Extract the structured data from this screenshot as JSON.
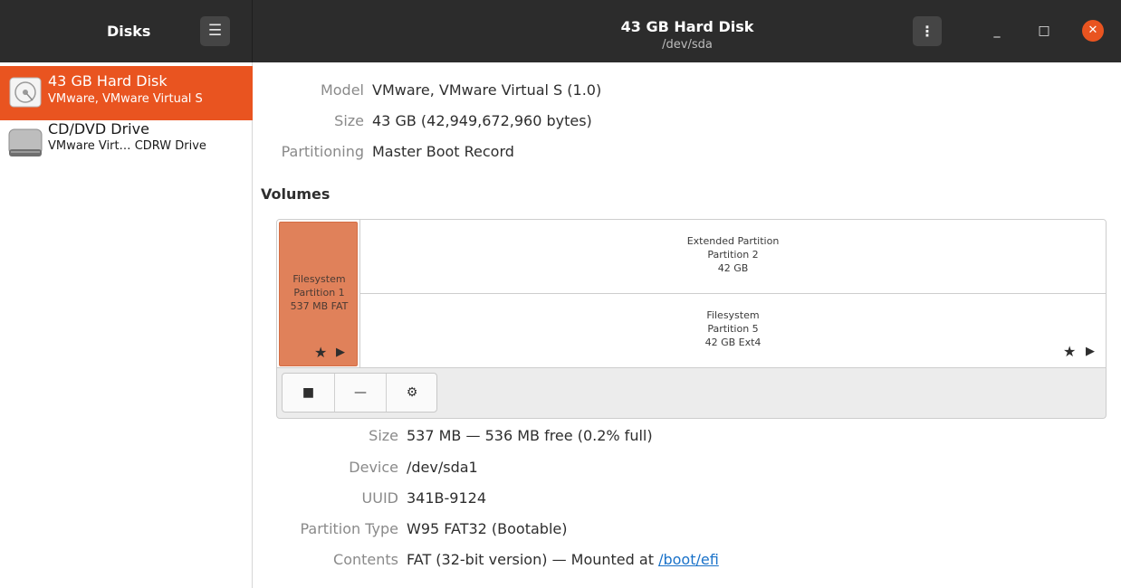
{
  "header": {
    "app_title": "Disks",
    "menu_icon": "hamburger-icon",
    "title": "43 GB Hard Disk",
    "subtitle": "/dev/sda",
    "kebab_icon": "vertical-dots-icon",
    "minimize_glyph": "_",
    "maximize_glyph": "□",
    "close_glyph": "✕",
    "close_color": "#e95420"
  },
  "sidebar": {
    "drives": [
      {
        "name": "43 GB Hard Disk",
        "subtitle": "VMware, VMware Virtual S",
        "icon": "hard-disk-icon",
        "selected": true
      },
      {
        "name": "CD/DVD Drive",
        "subtitle": "VMware Virt… CDRW Drive",
        "icon": "optical-drive-icon",
        "selected": false
      }
    ],
    "selected_color": "#e95420"
  },
  "disk_info": {
    "model_label": "Model",
    "model_value": "VMware, VMware Virtual S (1.0)",
    "size_label": "Size",
    "size_value": "43 GB (42,949,672,960 bytes)",
    "partitioning_label": "Partitioning",
    "partitioning_value": "Master Boot Record"
  },
  "volumes": {
    "heading": "Volumes",
    "partition1": {
      "line1": "Filesystem",
      "line2": "Partition 1",
      "line3": "537 MB FAT",
      "selected": true
    },
    "extended": {
      "line1": "Extended Partition",
      "line2": "Partition 2",
      "line3": "42 GB"
    },
    "partition5": {
      "line1": "Filesystem",
      "line2": "Partition 5",
      "line3": "42 GB Ext4"
    },
    "star_glyph": "★",
    "play_glyph": "▶",
    "toolbar": {
      "stop_glyph": "■",
      "minus_glyph": "—",
      "gear_glyph": "⚙"
    }
  },
  "partition_info": {
    "size_label": "Size",
    "size_value": "537 MB — 536 MB free (0.2% full)",
    "device_label": "Device",
    "device_value": "/dev/sda1",
    "uuid_label": "UUID",
    "uuid_value": "341B-9124",
    "type_label": "Partition Type",
    "type_value": "W95 FAT32 (Bootable)",
    "contents_label": "Contents",
    "contents_value": "FAT (32-bit version) — Mounted at",
    "mount_link": "/boot/efi"
  }
}
